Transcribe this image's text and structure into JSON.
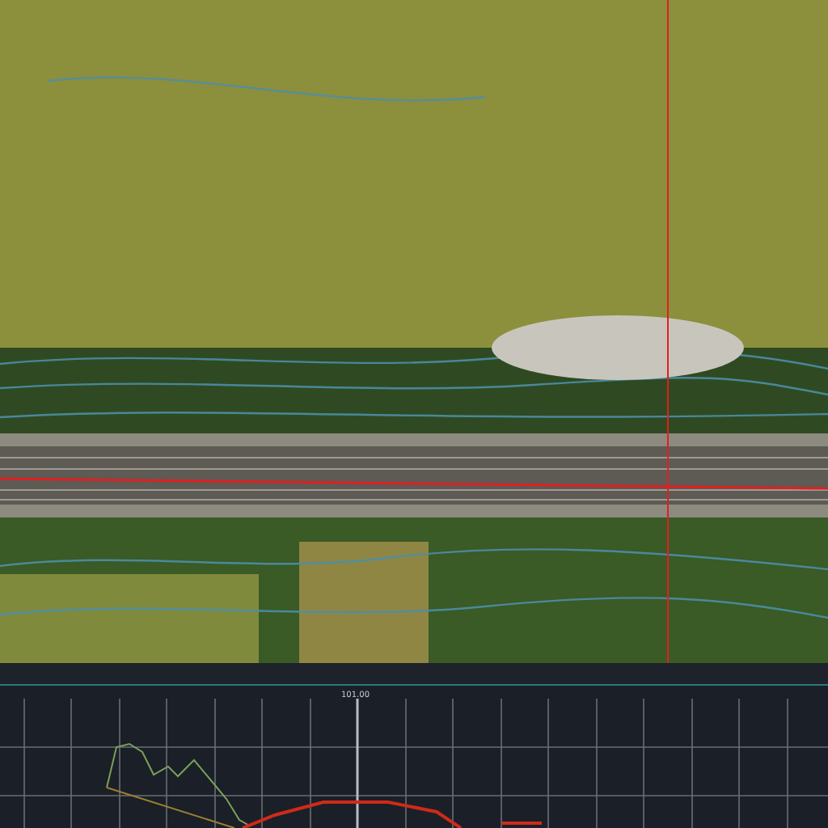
{
  "profile_panel": {
    "cursor_label": "101.00"
  }
}
